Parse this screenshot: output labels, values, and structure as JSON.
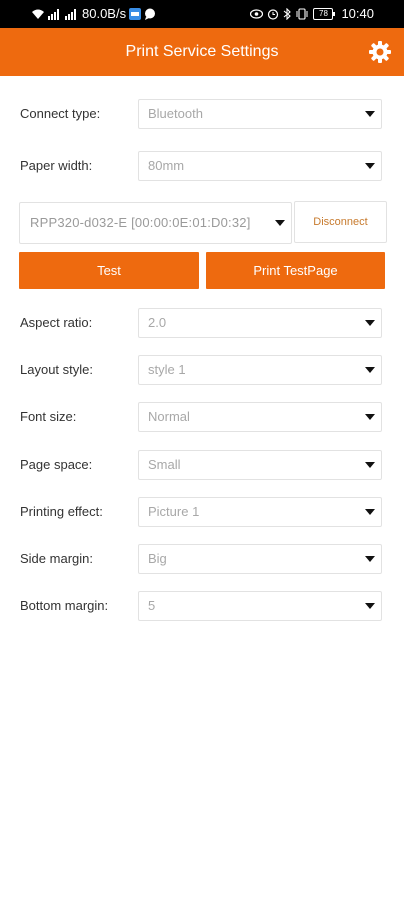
{
  "status_bar": {
    "network_speed": "80.0B/s",
    "battery": "78",
    "time": "10:40",
    "left_icons": [
      "wifi-icon",
      "signal-icon",
      "signal-icon",
      "messenger-icon",
      "chat-icon"
    ],
    "right_icons": [
      "eye-icon",
      "alarm-icon",
      "bluetooth-icon",
      "vibrate-icon",
      "battery-icon"
    ]
  },
  "header": {
    "title": "Print Service Settings",
    "settings_icon": "gear-icon"
  },
  "settings_top": [
    {
      "label": "Connect type:",
      "value": "Bluetooth"
    },
    {
      "label": "Paper width:",
      "value": "80mm"
    }
  ],
  "device": {
    "value": "RPP320-d032-E   [00:00:0E:01:D0:32]",
    "disconnect_label": "Disconnect"
  },
  "actions": {
    "test_label": "Test",
    "print_test_page_label": "Print TestPage"
  },
  "settings_bottom": [
    {
      "label": "Aspect ratio:",
      "value": "2.0"
    },
    {
      "label": "Layout style:",
      "value": "style 1"
    },
    {
      "label": "Font size:",
      "value": "Normal"
    },
    {
      "label": "Page space:",
      "value": "Small"
    },
    {
      "label": "Printing effect:",
      "value": "Picture 1"
    },
    {
      "label": "Side margin:",
      "value": "Big"
    },
    {
      "label": "Bottom margin:",
      "value": "5"
    }
  ],
  "colors": {
    "accent": "#ee6a0f",
    "disconnect_text": "#c77a2d",
    "value_text": "#a8a8a8"
  }
}
